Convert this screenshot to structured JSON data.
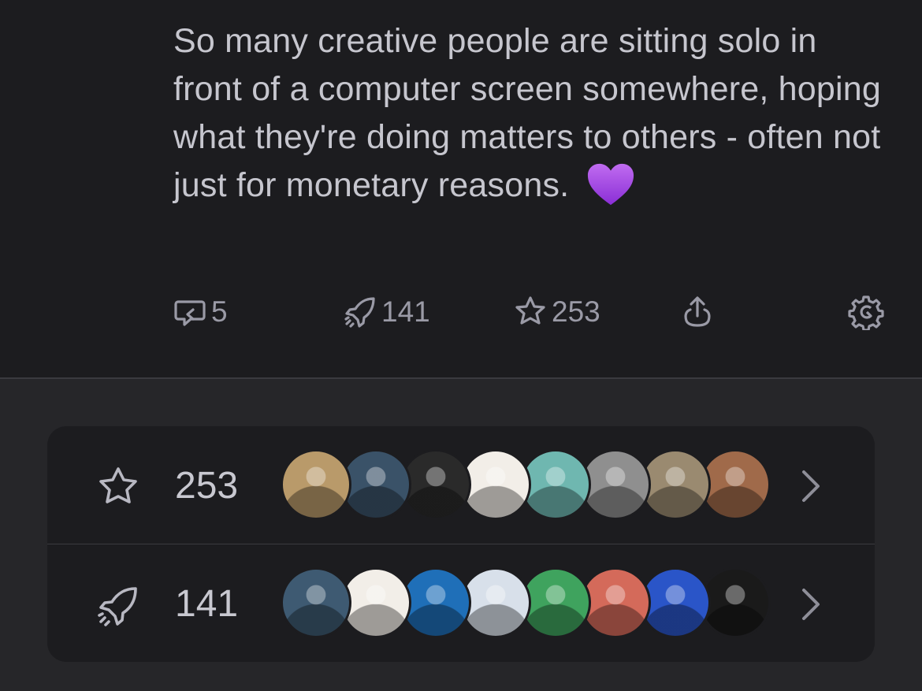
{
  "post": {
    "text": "So many creative people are sitting solo in front of a computer screen somewhere, hoping what they're doing matters to others - often not just for monetary reasons."
  },
  "actions": {
    "replies": "5",
    "boosts": "141",
    "favorites": "253"
  },
  "interactions": {
    "favorites": {
      "count": "253",
      "avatar_colors": [
        "#b99a6a",
        "#3a5268",
        "#2a2a2a",
        "#f2eee8",
        "#6fb7b0",
        "#8f8f8f",
        "#9a8a70",
        "#a06a4a"
      ]
    },
    "boosts": {
      "count": "141",
      "avatar_colors": [
        "#3e5a72",
        "#f2eee8",
        "#1f6fb8",
        "#d8e0ea",
        "#3fa35e",
        "#d46a5a",
        "#2a55c8",
        "#1a1a1a"
      ]
    }
  }
}
